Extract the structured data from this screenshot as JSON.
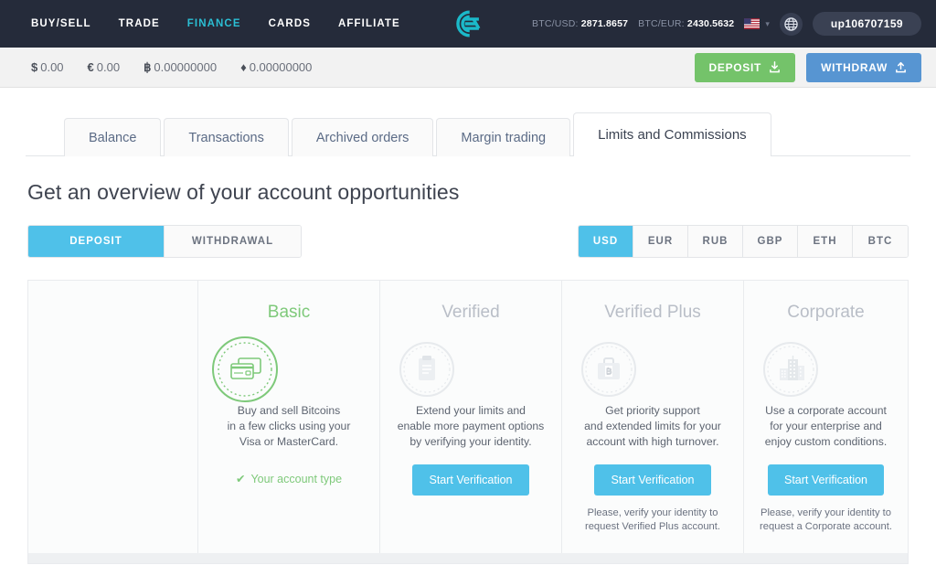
{
  "nav": {
    "items": [
      {
        "label": "BUY/SELL",
        "active": false
      },
      {
        "label": "TRADE",
        "active": false
      },
      {
        "label": "FINANCE",
        "active": true
      },
      {
        "label": "CARDS",
        "active": false
      },
      {
        "label": "AFFILIATE",
        "active": false
      }
    ],
    "logo_name": "cex-logo",
    "rates": [
      {
        "pair": "BTC/USD:",
        "value": "2871.8657"
      },
      {
        "pair": "BTC/EUR:",
        "value": "2430.5632"
      }
    ],
    "flag": "us-flag-icon",
    "globe": "globe-icon",
    "username": "up106707159"
  },
  "balances": [
    {
      "symbol": "$",
      "amount": "0.00"
    },
    {
      "symbol": "€",
      "amount": "0.00"
    },
    {
      "symbol": "฿",
      "amount": "0.00000000"
    },
    {
      "symbol": "♦",
      "amount": "0.00000000"
    }
  ],
  "actions": {
    "deposit": "DEPOSIT",
    "withdraw": "WITHDRAW"
  },
  "tabs": [
    {
      "label": "Balance",
      "active": false
    },
    {
      "label": "Transactions",
      "active": false
    },
    {
      "label": "Archived orders",
      "active": false
    },
    {
      "label": "Margin trading",
      "active": false
    },
    {
      "label": "Limits and Commissions",
      "active": true
    }
  ],
  "page": {
    "title": "Get an overview of your account opportunities"
  },
  "direction_toggle": [
    {
      "label": "DEPOSIT",
      "active": true
    },
    {
      "label": "WITHDRAWAL",
      "active": false
    }
  ],
  "currencies": [
    {
      "label": "USD",
      "active": true
    },
    {
      "label": "EUR",
      "active": false
    },
    {
      "label": "RUB",
      "active": false
    },
    {
      "label": "GBP",
      "active": false
    },
    {
      "label": "ETH",
      "active": false
    },
    {
      "label": "BTC",
      "active": false
    }
  ],
  "accounts": [
    {
      "name": "Basic",
      "icon": "credit-cards-icon",
      "description": "Buy and sell Bitcoins\nin a few clicks using your\nVisa or MasterCard.",
      "current_label": "Your account type",
      "button": null,
      "note": null
    },
    {
      "name": "Verified",
      "icon": "clipboard-icon",
      "description": "Extend your limits and\nenable more payment options\nby verifying your identity.",
      "current_label": null,
      "button": "Start Verification",
      "note": null
    },
    {
      "name": "Verified Plus",
      "icon": "briefcase-bitcoin-icon",
      "description": "Get priority support\nand extended limits for your\naccount with high turnover.",
      "current_label": null,
      "button": "Start Verification",
      "note": "Please, verify your identity to\nrequest Verified Plus account."
    },
    {
      "name": "Corporate",
      "icon": "office-buildings-icon",
      "description": "Use a corporate account\nfor your enterprise and\nenjoy custom conditions.",
      "current_label": null,
      "button": "Start Verification",
      "note": "Please, verify your identity to\nrequest a Corporate account."
    }
  ],
  "colors": {
    "nav_bg": "#252b3a",
    "accent_teal": "#2bbfd4",
    "accent_blue": "#4fc1e9",
    "green": "#74c36a",
    "basic_green": "#7ec97a",
    "withdraw_blue": "#5795d2"
  }
}
